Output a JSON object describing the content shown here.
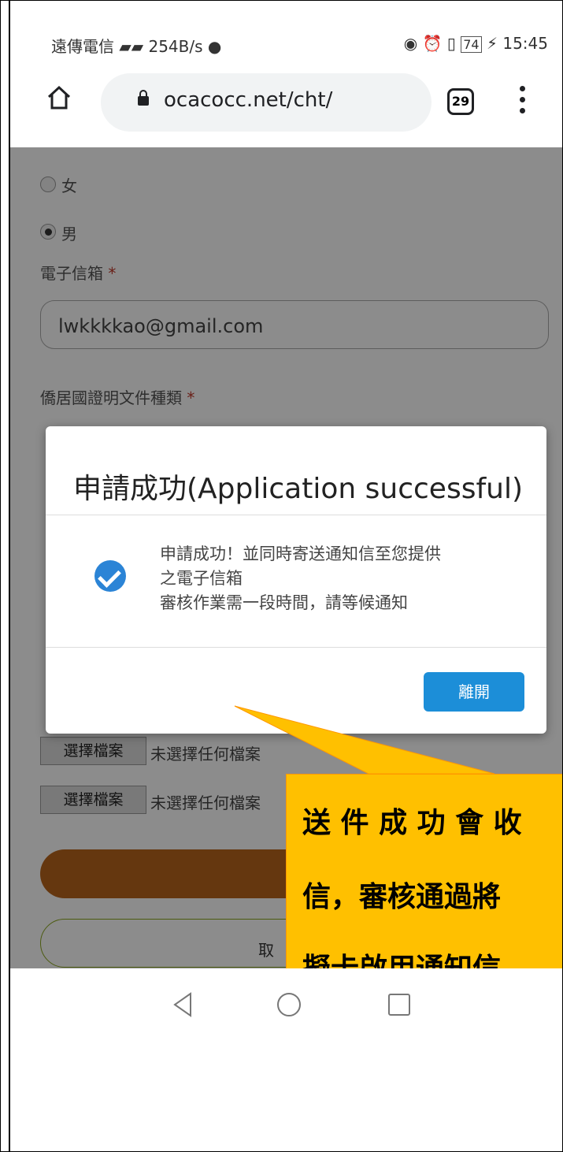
{
  "status_bar": {
    "carrier": "遠傳電信",
    "net_speed": "254B/s",
    "battery": "74",
    "time": "15:45"
  },
  "address_bar": {
    "url": "ocacocc.net/cht/",
    "tab_count": "29"
  },
  "form": {
    "gender_female": "女",
    "gender_male": "男",
    "email_label": "電子信箱",
    "required_mark": "*",
    "email_value": "lwkkkkao@gmail.com",
    "doc_type_label": "僑居國證明文件種類",
    "file_button_label": "選擇檔案",
    "no_file_text": "未選擇任何檔案",
    "cancel_label": "取"
  },
  "modal": {
    "title": "申請成功(Application successful)",
    "message_lines": [
      "申請成功！並同時寄送通知信至您提供",
      "之電子信箱",
      "審核作業需一段時間，請等候通知"
    ],
    "leave_button": "離開"
  },
  "callout": {
    "lines": [
      "送 件 成 功 會 收",
      "信，審核通過將",
      "擬卡啟用通知信"
    ]
  },
  "colors": {
    "callout_bg": "#ffc000",
    "modal_button": "#1c8ed8",
    "submit_button": "#b8651d",
    "check_icon": "#2b84d6"
  }
}
